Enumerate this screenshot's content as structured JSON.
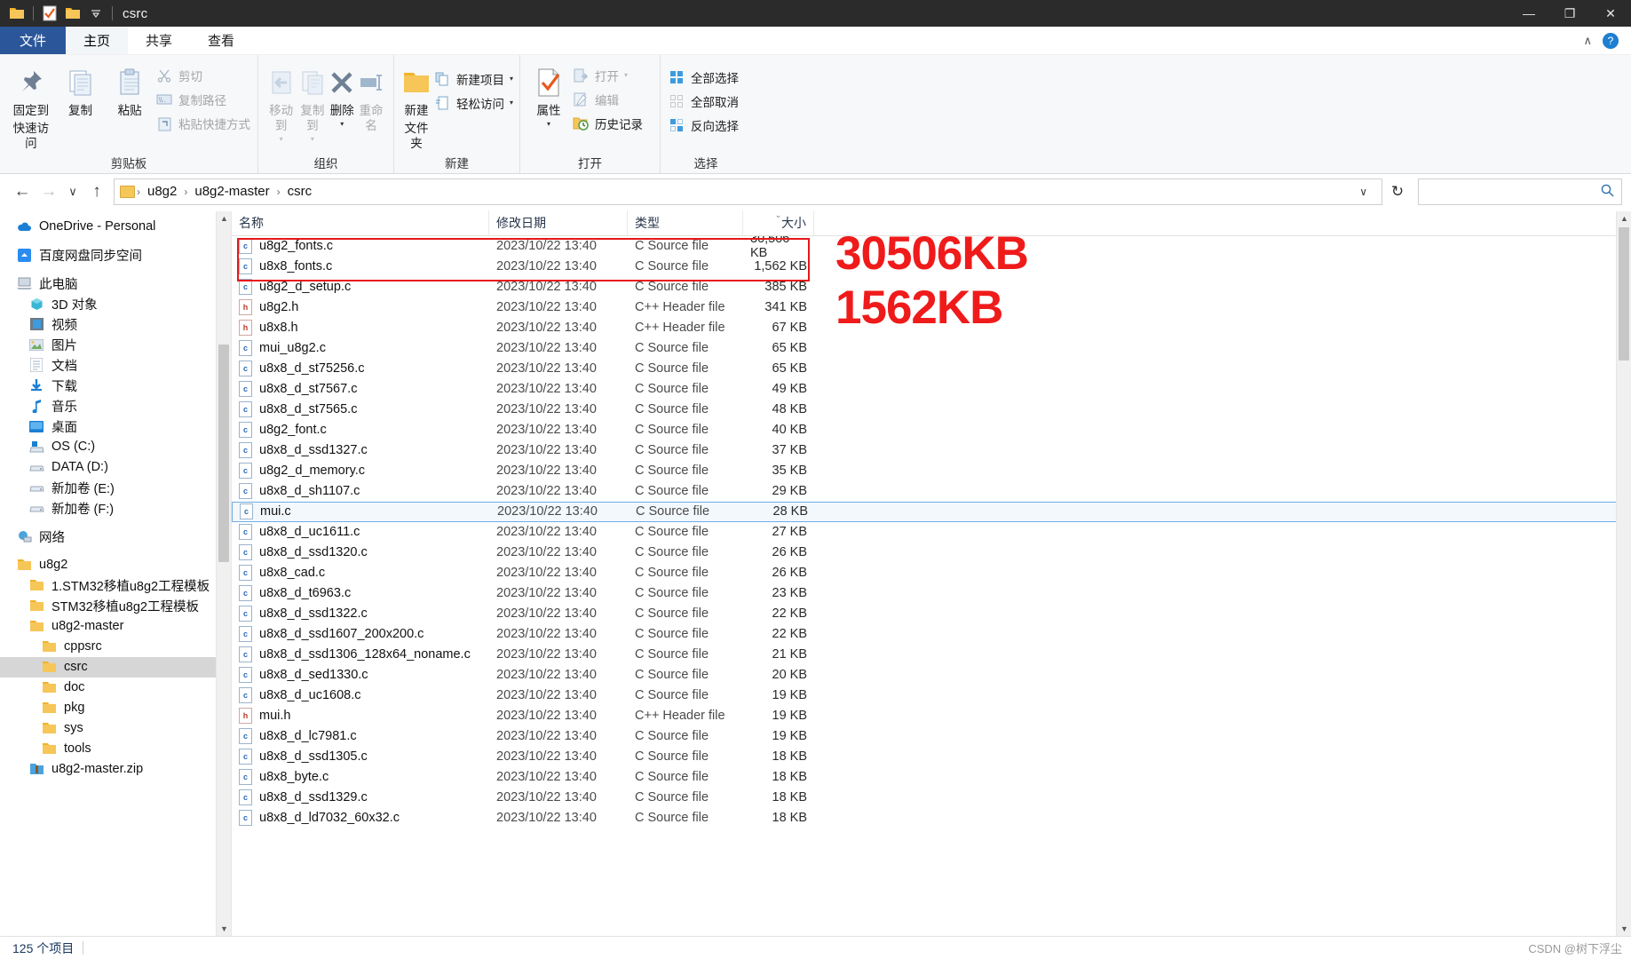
{
  "window": {
    "title": "csrc",
    "quick_access_icons": [
      "folder-icon",
      "properties-check-icon",
      "new-folder-icon",
      "customize-caret-icon"
    ],
    "minimize": "—",
    "maximize": "❐",
    "close": "✕"
  },
  "ribbon": {
    "tabs": [
      {
        "label": "文件",
        "kind": "file"
      },
      {
        "label": "主页",
        "kind": "active"
      },
      {
        "label": "共享",
        "kind": "normal"
      },
      {
        "label": "查看",
        "kind": "normal"
      }
    ],
    "collapse_caret": "∧",
    "help": "?",
    "groups": [
      {
        "label": "剪贴板",
        "big": [
          {
            "label_line1": "固定到",
            "label_line2": "快速访问",
            "icon": "pin-icon",
            "disabled": false
          },
          {
            "label_line1": "复制",
            "label_line2": "",
            "icon": "copy-icon",
            "disabled": false
          },
          {
            "label_line1": "粘贴",
            "label_line2": "",
            "icon": "paste-icon",
            "disabled": false
          }
        ],
        "small": [
          {
            "label": "剪切",
            "icon": "scissors-icon",
            "disabled": true
          },
          {
            "label": "复制路径",
            "icon": "copy-path-icon",
            "disabled": true
          },
          {
            "label": "粘贴快捷方式",
            "icon": "paste-shortcut-icon",
            "disabled": true
          }
        ]
      },
      {
        "label": "组织",
        "big": [
          {
            "label_line1": "移动到",
            "label_line2": "",
            "icon": "move-to-icon",
            "disabled": true,
            "caret": true
          },
          {
            "label_line1": "复制到",
            "label_line2": "",
            "icon": "copy-to-icon",
            "disabled": true,
            "caret": true
          },
          {
            "label_line1": "删除",
            "label_line2": "",
            "icon": "delete-x-icon",
            "disabled": false,
            "caret": true
          },
          {
            "label_line1": "重命名",
            "label_line2": "",
            "icon": "rename-icon",
            "disabled": true
          }
        ],
        "small": []
      },
      {
        "label": "新建",
        "big": [
          {
            "label_line1": "新建",
            "label_line2": "文件夹",
            "icon": "new-folder-icon",
            "disabled": false
          }
        ],
        "small": [
          {
            "label": "新建项目",
            "icon": "new-item-icon",
            "disabled": false,
            "caret": true
          },
          {
            "label": "轻松访问",
            "icon": "easy-access-icon",
            "disabled": false,
            "caret": true
          }
        ]
      },
      {
        "label": "打开",
        "big": [
          {
            "label_line1": "属性",
            "label_line2": "",
            "icon": "properties-check-icon",
            "disabled": false,
            "caret": true
          }
        ],
        "small": [
          {
            "label": "打开",
            "icon": "open-icon",
            "disabled": true,
            "caret": true
          },
          {
            "label": "编辑",
            "icon": "edit-icon",
            "disabled": true
          },
          {
            "label": "历史记录",
            "icon": "history-icon",
            "disabled": false
          }
        ]
      },
      {
        "label": "选择",
        "big": [],
        "small": [
          {
            "label": "全部选择",
            "icon": "select-all-icon",
            "disabled": false
          },
          {
            "label": "全部取消",
            "icon": "select-none-icon",
            "disabled": false
          },
          {
            "label": "反向选择",
            "icon": "invert-selection-icon",
            "disabled": false
          }
        ]
      }
    ]
  },
  "addressbar": {
    "back": "←",
    "forward": "→",
    "recent": "∨",
    "up": "↑",
    "crumbs": [
      "u8g2",
      "u8g2-master",
      "csrc"
    ],
    "crumb_sep": "›",
    "dropdown_caret": "∨",
    "refresh": "↻",
    "search_placeholder": "",
    "search_icon": "search-icon"
  },
  "navpane": {
    "items": [
      {
        "label": "OneDrive - Personal",
        "icon": "onedrive-icon",
        "indent": 0,
        "gap_before": false
      },
      {
        "label": "百度网盘同步空间",
        "icon": "baidu-netdisk-icon",
        "indent": 0,
        "gap_before": true
      },
      {
        "label": "此电脑",
        "icon": "this-pc-icon",
        "indent": 0,
        "gap_before": true
      },
      {
        "label": "3D 对象",
        "icon": "3d-objects-icon",
        "indent": 1,
        "gap_before": false
      },
      {
        "label": "视频",
        "icon": "videos-icon",
        "indent": 1,
        "gap_before": false
      },
      {
        "label": "图片",
        "icon": "pictures-icon",
        "indent": 1,
        "gap_before": false
      },
      {
        "label": "文档",
        "icon": "documents-icon",
        "indent": 1,
        "gap_before": false
      },
      {
        "label": "下载",
        "icon": "downloads-icon",
        "indent": 1,
        "gap_before": false
      },
      {
        "label": "音乐",
        "icon": "music-icon",
        "indent": 1,
        "gap_before": false
      },
      {
        "label": "桌面",
        "icon": "desktop-icon",
        "indent": 1,
        "gap_before": false
      },
      {
        "label": "OS (C:)",
        "icon": "os-drive-icon",
        "indent": 1,
        "gap_before": false
      },
      {
        "label": "DATA (D:)",
        "icon": "drive-icon",
        "indent": 1,
        "gap_before": false
      },
      {
        "label": "新加卷 (E:)",
        "icon": "drive-icon",
        "indent": 1,
        "gap_before": false
      },
      {
        "label": "新加卷 (F:)",
        "icon": "drive-icon",
        "indent": 1,
        "gap_before": false
      },
      {
        "label": "网络",
        "icon": "network-icon",
        "indent": 0,
        "gap_before": true
      },
      {
        "label": "u8g2",
        "icon": "folder-icon",
        "indent": 0,
        "gap_before": true
      },
      {
        "label": "1.STM32移植u8g2工程模板",
        "icon": "folder-icon",
        "indent": 1,
        "gap_before": false
      },
      {
        "label": "STM32移植u8g2工程模板",
        "icon": "folder-icon",
        "indent": 1,
        "gap_before": false
      },
      {
        "label": "u8g2-master",
        "icon": "folder-icon",
        "indent": 1,
        "gap_before": false
      },
      {
        "label": "cppsrc",
        "icon": "folder-icon",
        "indent": 2,
        "gap_before": false
      },
      {
        "label": "csrc",
        "icon": "folder-icon",
        "indent": 2,
        "gap_before": false,
        "selected": true
      },
      {
        "label": "doc",
        "icon": "folder-icon",
        "indent": 2,
        "gap_before": false
      },
      {
        "label": "pkg",
        "icon": "folder-icon",
        "indent": 2,
        "gap_before": false
      },
      {
        "label": "sys",
        "icon": "folder-icon",
        "indent": 2,
        "gap_before": false
      },
      {
        "label": "tools",
        "icon": "folder-icon",
        "indent": 2,
        "gap_before": false
      },
      {
        "label": "u8g2-master.zip",
        "icon": "zip-icon",
        "indent": 1,
        "gap_before": false
      }
    ]
  },
  "filelist": {
    "columns": [
      "名称",
      "修改日期",
      "类型",
      "大小"
    ],
    "sorted_column": "大小",
    "sort_caret": "⌄",
    "rows": [
      {
        "name": "u8g2_fonts.c",
        "date": "2023/10/22 13:40",
        "type": "C Source file",
        "size": "30,506 KB",
        "icon": "c-file-icon"
      },
      {
        "name": "u8x8_fonts.c",
        "date": "2023/10/22 13:40",
        "type": "C Source file",
        "size": "1,562 KB",
        "icon": "c-file-icon"
      },
      {
        "name": "u8g2_d_setup.c",
        "date": "2023/10/22 13:40",
        "type": "C Source file",
        "size": "385 KB",
        "icon": "c-file-icon"
      },
      {
        "name": "u8g2.h",
        "date": "2023/10/22 13:40",
        "type": "C++ Header file",
        "size": "341 KB",
        "icon": "h-file-icon"
      },
      {
        "name": "u8x8.h",
        "date": "2023/10/22 13:40",
        "type": "C++ Header file",
        "size": "67 KB",
        "icon": "h-file-icon"
      },
      {
        "name": "mui_u8g2.c",
        "date": "2023/10/22 13:40",
        "type": "C Source file",
        "size": "65 KB",
        "icon": "c-file-icon"
      },
      {
        "name": "u8x8_d_st75256.c",
        "date": "2023/10/22 13:40",
        "type": "C Source file",
        "size": "65 KB",
        "icon": "c-file-icon"
      },
      {
        "name": "u8x8_d_st7567.c",
        "date": "2023/10/22 13:40",
        "type": "C Source file",
        "size": "49 KB",
        "icon": "c-file-icon"
      },
      {
        "name": "u8x8_d_st7565.c",
        "date": "2023/10/22 13:40",
        "type": "C Source file",
        "size": "48 KB",
        "icon": "c-file-icon"
      },
      {
        "name": "u8g2_font.c",
        "date": "2023/10/22 13:40",
        "type": "C Source file",
        "size": "40 KB",
        "icon": "c-file-icon"
      },
      {
        "name": "u8x8_d_ssd1327.c",
        "date": "2023/10/22 13:40",
        "type": "C Source file",
        "size": "37 KB",
        "icon": "c-file-icon"
      },
      {
        "name": "u8g2_d_memory.c",
        "date": "2023/10/22 13:40",
        "type": "C Source file",
        "size": "35 KB",
        "icon": "c-file-icon"
      },
      {
        "name": "u8x8_d_sh1107.c",
        "date": "2023/10/22 13:40",
        "type": "C Source file",
        "size": "29 KB",
        "icon": "c-file-icon"
      },
      {
        "name": "mui.c",
        "date": "2023/10/22 13:40",
        "type": "C Source file",
        "size": "28 KB",
        "icon": "c-file-icon",
        "selected": true
      },
      {
        "name": "u8x8_d_uc1611.c",
        "date": "2023/10/22 13:40",
        "type": "C Source file",
        "size": "27 KB",
        "icon": "c-file-icon"
      },
      {
        "name": "u8x8_d_ssd1320.c",
        "date": "2023/10/22 13:40",
        "type": "C Source file",
        "size": "26 KB",
        "icon": "c-file-icon"
      },
      {
        "name": "u8x8_cad.c",
        "date": "2023/10/22 13:40",
        "type": "C Source file",
        "size": "26 KB",
        "icon": "c-file-icon"
      },
      {
        "name": "u8x8_d_t6963.c",
        "date": "2023/10/22 13:40",
        "type": "C Source file",
        "size": "23 KB",
        "icon": "c-file-icon"
      },
      {
        "name": "u8x8_d_ssd1322.c",
        "date": "2023/10/22 13:40",
        "type": "C Source file",
        "size": "22 KB",
        "icon": "c-file-icon"
      },
      {
        "name": "u8x8_d_ssd1607_200x200.c",
        "date": "2023/10/22 13:40",
        "type": "C Source file",
        "size": "22 KB",
        "icon": "c-file-icon"
      },
      {
        "name": "u8x8_d_ssd1306_128x64_noname.c",
        "date": "2023/10/22 13:40",
        "type": "C Source file",
        "size": "21 KB",
        "icon": "c-file-icon"
      },
      {
        "name": "u8x8_d_sed1330.c",
        "date": "2023/10/22 13:40",
        "type": "C Source file",
        "size": "20 KB",
        "icon": "c-file-icon"
      },
      {
        "name": "u8x8_d_uc1608.c",
        "date": "2023/10/22 13:40",
        "type": "C Source file",
        "size": "19 KB",
        "icon": "c-file-icon"
      },
      {
        "name": "mui.h",
        "date": "2023/10/22 13:40",
        "type": "C++ Header file",
        "size": "19 KB",
        "icon": "h-file-icon"
      },
      {
        "name": "u8x8_d_lc7981.c",
        "date": "2023/10/22 13:40",
        "type": "C Source file",
        "size": "19 KB",
        "icon": "c-file-icon"
      },
      {
        "name": "u8x8_d_ssd1305.c",
        "date": "2023/10/22 13:40",
        "type": "C Source file",
        "size": "18 KB",
        "icon": "c-file-icon"
      },
      {
        "name": "u8x8_byte.c",
        "date": "2023/10/22 13:40",
        "type": "C Source file",
        "size": "18 KB",
        "icon": "c-file-icon"
      },
      {
        "name": "u8x8_d_ssd1329.c",
        "date": "2023/10/22 13:40",
        "type": "C Source file",
        "size": "18 KB",
        "icon": "c-file-icon"
      },
      {
        "name": "u8x8_d_ld7032_60x32.c",
        "date": "2023/10/22 13:40",
        "type": "C Source file",
        "size": "18 KB",
        "icon": "c-file-icon"
      }
    ]
  },
  "annotations": {
    "color": "#ef1b1b",
    "lines": [
      "30506KB",
      "1562KB"
    ]
  },
  "statusbar": {
    "item_count": "125 个项目"
  },
  "watermark": {
    "text": "CSDN @树下浮尘"
  }
}
